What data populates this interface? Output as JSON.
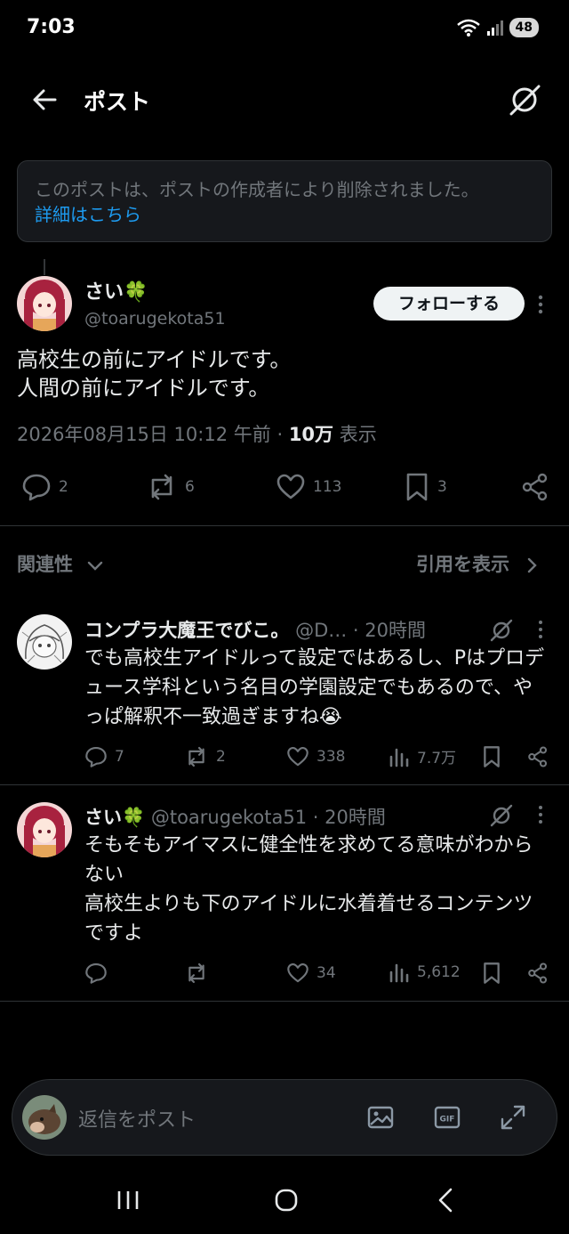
{
  "status_bar": {
    "time": "7:03",
    "battery": "48"
  },
  "header": {
    "title": "ポスト"
  },
  "notice": {
    "text": "このポストは、ポストの作成者により削除されました。",
    "link": "詳細はこちら"
  },
  "post": {
    "name": "さい🍀",
    "handle": "@toarugekota51",
    "follow_label": "フォローする",
    "body": "高校生の前にアイドルです。\n人間の前にアイドルです。",
    "datetime": "2026年08月15日 10:12 午前",
    "views": "10万",
    "views_label": "表示",
    "replies": "2",
    "reposts": "6",
    "likes": "113",
    "bookmarks": "3"
  },
  "sort": {
    "label": "関連性",
    "quotes_label": "引用を表示"
  },
  "replies": [
    {
      "name": "コンプラ大魔王でびこ。",
      "handle": "@D…",
      "time": "· 20時間",
      "body": "でも高校生アイドルって設定ではあるし、Pはプロデュース学科という名目の学園設定でもあるので、やっぱ解釈不一致過ぎますね😭",
      "replies": "7",
      "reposts": "2",
      "likes": "338",
      "views": "7.7万"
    },
    {
      "name": "さい🍀",
      "handle": "@toarugekota51",
      "time": "· 20時間",
      "body": "そもそもアイマスに健全性を求めてる意味がわからない\n高校生よりも下のアイドルに水着着せるコンテンツですよ",
      "replies": "",
      "reposts": "",
      "likes": "34",
      "views": "5,612"
    }
  ],
  "compose": {
    "placeholder": "返信をポスト"
  },
  "colors": {
    "background": "#000000",
    "accent": "#1d9bf0",
    "muted": "#71767b",
    "text": "#e7e9ea"
  }
}
